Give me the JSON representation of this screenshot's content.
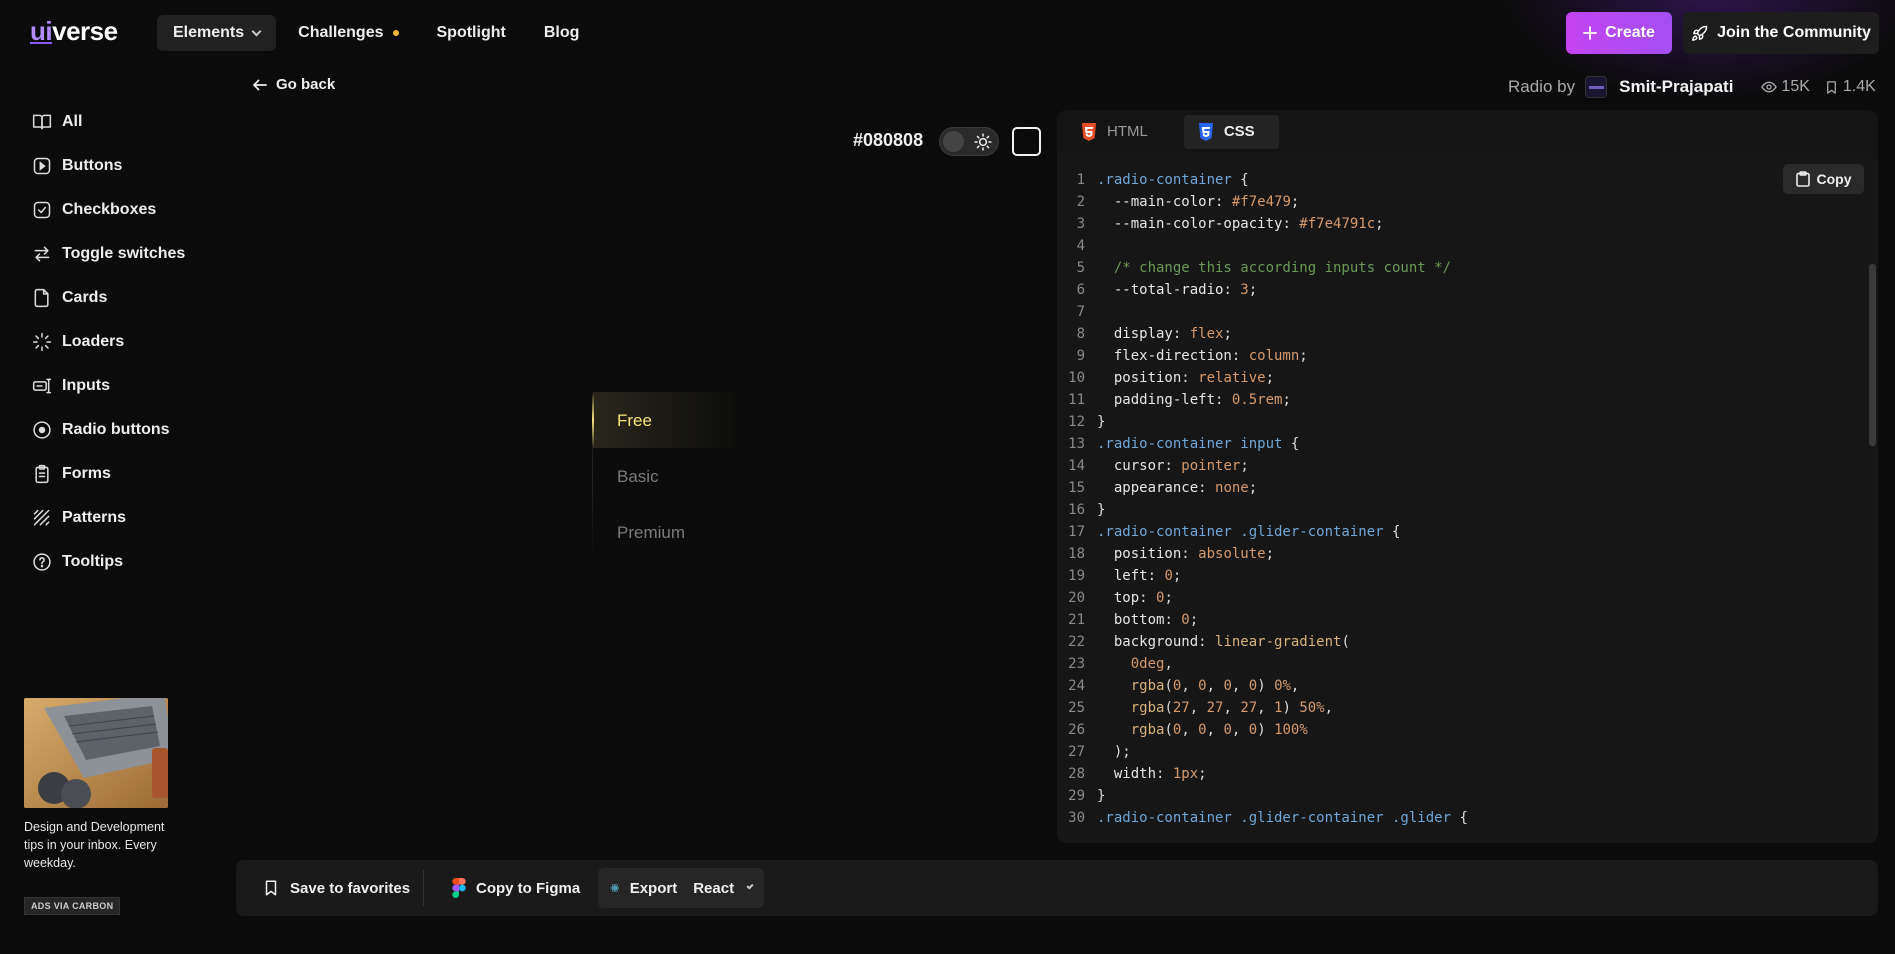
{
  "header": {
    "logo_prefix": "ui",
    "logo_rest": "verse",
    "nav": [
      {
        "label": "Elements"
      },
      {
        "label": "Challenges"
      },
      {
        "label": "Spotlight"
      },
      {
        "label": "Blog"
      }
    ],
    "create_label": "Create",
    "community_label": "Join the Community"
  },
  "sidebar": {
    "items": [
      {
        "label": "All",
        "icon": "book-icon"
      },
      {
        "label": "Buttons",
        "icon": "button-icon"
      },
      {
        "label": "Checkboxes",
        "icon": "checkbox-icon"
      },
      {
        "label": "Toggle switches",
        "icon": "arrows-swap-icon"
      },
      {
        "label": "Cards",
        "icon": "card-icon"
      },
      {
        "label": "Loaders",
        "icon": "loader-icon"
      },
      {
        "label": "Inputs",
        "icon": "input-icon"
      },
      {
        "label": "Radio buttons",
        "icon": "radio-icon"
      },
      {
        "label": "Forms",
        "icon": "clipboard-icon"
      },
      {
        "label": "Patterns",
        "icon": "pattern-icon"
      },
      {
        "label": "Tooltips",
        "icon": "help-circle-icon"
      }
    ],
    "ad": {
      "text": "Design and Development tips in your inbox. Every weekday.",
      "tag": "ADS VIA CARBON"
    }
  },
  "preview": {
    "go_back": "Go back",
    "bg_color_label": "#080808",
    "options": [
      "Free",
      "Basic",
      "Premium"
    ],
    "selected_index": 0,
    "accent": "#f7e479"
  },
  "author": {
    "prefix": "Radio by",
    "name": "Smit-Prajapati",
    "views": "15K",
    "saves": "1.4K"
  },
  "code_panel": {
    "tabs": [
      {
        "label": "HTML",
        "icon": "html5-icon",
        "active": false
      },
      {
        "label": "CSS",
        "icon": "css3-icon",
        "active": true
      }
    ],
    "copy_label": "Copy",
    "lines": [
      [
        {
          "t": ".radio-container ",
          "c": "sel"
        },
        {
          "t": "{",
          "c": "p"
        }
      ],
      [
        {
          "t": "  --main-color",
          "c": "prop"
        },
        {
          "t": ": ",
          "c": "p"
        },
        {
          "t": "#f7e479",
          "c": "val"
        },
        {
          "t": ";",
          "c": "p"
        }
      ],
      [
        {
          "t": "  --main-color-opacity",
          "c": "prop"
        },
        {
          "t": ": ",
          "c": "p"
        },
        {
          "t": "#f7e4791c",
          "c": "val"
        },
        {
          "t": ";",
          "c": "p"
        }
      ],
      [],
      [
        {
          "t": "  /* change this according inputs count */",
          "c": "com"
        }
      ],
      [
        {
          "t": "  --total-radio",
          "c": "prop"
        },
        {
          "t": ": ",
          "c": "p"
        },
        {
          "t": "3",
          "c": "val"
        },
        {
          "t": ";",
          "c": "p"
        }
      ],
      [],
      [
        {
          "t": "  display",
          "c": "prop"
        },
        {
          "t": ": ",
          "c": "p"
        },
        {
          "t": "flex",
          "c": "val"
        },
        {
          "t": ";",
          "c": "p"
        }
      ],
      [
        {
          "t": "  flex-direction",
          "c": "prop"
        },
        {
          "t": ": ",
          "c": "p"
        },
        {
          "t": "column",
          "c": "val"
        },
        {
          "t": ";",
          "c": "p"
        }
      ],
      [
        {
          "t": "  position",
          "c": "prop"
        },
        {
          "t": ": ",
          "c": "p"
        },
        {
          "t": "relative",
          "c": "val"
        },
        {
          "t": ";",
          "c": "p"
        }
      ],
      [
        {
          "t": "  padding-left",
          "c": "prop"
        },
        {
          "t": ": ",
          "c": "p"
        },
        {
          "t": "0.5rem",
          "c": "val"
        },
        {
          "t": ";",
          "c": "p"
        }
      ],
      [
        {
          "t": "}",
          "c": "p"
        }
      ],
      [
        {
          "t": ".radio-container input ",
          "c": "sel"
        },
        {
          "t": "{",
          "c": "p"
        }
      ],
      [
        {
          "t": "  cursor",
          "c": "prop"
        },
        {
          "t": ": ",
          "c": "p"
        },
        {
          "t": "pointer",
          "c": "val"
        },
        {
          "t": ";",
          "c": "p"
        }
      ],
      [
        {
          "t": "  appearance",
          "c": "prop"
        },
        {
          "t": ": ",
          "c": "p"
        },
        {
          "t": "none",
          "c": "val"
        },
        {
          "t": ";",
          "c": "p"
        }
      ],
      [
        {
          "t": "}",
          "c": "p"
        }
      ],
      [
        {
          "t": ".radio-container .glider-container ",
          "c": "sel"
        },
        {
          "t": "{",
          "c": "p"
        }
      ],
      [
        {
          "t": "  position",
          "c": "prop"
        },
        {
          "t": ": ",
          "c": "p"
        },
        {
          "t": "absolute",
          "c": "val"
        },
        {
          "t": ";",
          "c": "p"
        }
      ],
      [
        {
          "t": "  left",
          "c": "prop"
        },
        {
          "t": ": ",
          "c": "p"
        },
        {
          "t": "0",
          "c": "val"
        },
        {
          "t": ";",
          "c": "p"
        }
      ],
      [
        {
          "t": "  top",
          "c": "prop"
        },
        {
          "t": ": ",
          "c": "p"
        },
        {
          "t": "0",
          "c": "val"
        },
        {
          "t": ";",
          "c": "p"
        }
      ],
      [
        {
          "t": "  bottom",
          "c": "prop"
        },
        {
          "t": ": ",
          "c": "p"
        },
        {
          "t": "0",
          "c": "val"
        },
        {
          "t": ";",
          "c": "p"
        }
      ],
      [
        {
          "t": "  background",
          "c": "prop"
        },
        {
          "t": ": ",
          "c": "p"
        },
        {
          "t": "linear-gradient",
          "c": "fn"
        },
        {
          "t": "(",
          "c": "p"
        }
      ],
      [
        {
          "t": "    0deg",
          "c": "val"
        },
        {
          "t": ",",
          "c": "p"
        }
      ],
      [
        {
          "t": "    rgba",
          "c": "fn"
        },
        {
          "t": "(",
          "c": "p"
        },
        {
          "t": "0",
          "c": "val"
        },
        {
          "t": ", ",
          "c": "p"
        },
        {
          "t": "0",
          "c": "val"
        },
        {
          "t": ", ",
          "c": "p"
        },
        {
          "t": "0",
          "c": "val"
        },
        {
          "t": ", ",
          "c": "p"
        },
        {
          "t": "0",
          "c": "val"
        },
        {
          "t": ") ",
          "c": "p"
        },
        {
          "t": "0%",
          "c": "val"
        },
        {
          "t": ",",
          "c": "p"
        }
      ],
      [
        {
          "t": "    rgba",
          "c": "fn"
        },
        {
          "t": "(",
          "c": "p"
        },
        {
          "t": "27",
          "c": "val"
        },
        {
          "t": ", ",
          "c": "p"
        },
        {
          "t": "27",
          "c": "val"
        },
        {
          "t": ", ",
          "c": "p"
        },
        {
          "t": "27",
          "c": "val"
        },
        {
          "t": ", ",
          "c": "p"
        },
        {
          "t": "1",
          "c": "val"
        },
        {
          "t": ") ",
          "c": "p"
        },
        {
          "t": "50%",
          "c": "val"
        },
        {
          "t": ",",
          "c": "p"
        }
      ],
      [
        {
          "t": "    rgba",
          "c": "fn"
        },
        {
          "t": "(",
          "c": "p"
        },
        {
          "t": "0",
          "c": "val"
        },
        {
          "t": ", ",
          "c": "p"
        },
        {
          "t": "0",
          "c": "val"
        },
        {
          "t": ", ",
          "c": "p"
        },
        {
          "t": "0",
          "c": "val"
        },
        {
          "t": ", ",
          "c": "p"
        },
        {
          "t": "0",
          "c": "val"
        },
        {
          "t": ") ",
          "c": "p"
        },
        {
          "t": "100%",
          "c": "val"
        }
      ],
      [
        {
          "t": "  );",
          "c": "p"
        }
      ],
      [
        {
          "t": "  width",
          "c": "prop"
        },
        {
          "t": ": ",
          "c": "p"
        },
        {
          "t": "1px",
          "c": "val"
        },
        {
          "t": ";",
          "c": "p"
        }
      ],
      [
        {
          "t": "}",
          "c": "p"
        }
      ],
      [
        {
          "t": ".radio-container .glider-container .glider ",
          "c": "sel"
        },
        {
          "t": "{",
          "c": "p"
        }
      ]
    ]
  },
  "bottom_bar": {
    "save_label": "Save to favorites",
    "figma_label": "Copy to Figma",
    "export_label": "Export",
    "framework_label": "React"
  },
  "colors": {
    "create_gradient_start": "#c444f2",
    "create_gradient_end": "#a44ff0",
    "radio_accent": "#f7e479",
    "html_icon": "#e44d26",
    "css_icon": "#2965f1"
  }
}
